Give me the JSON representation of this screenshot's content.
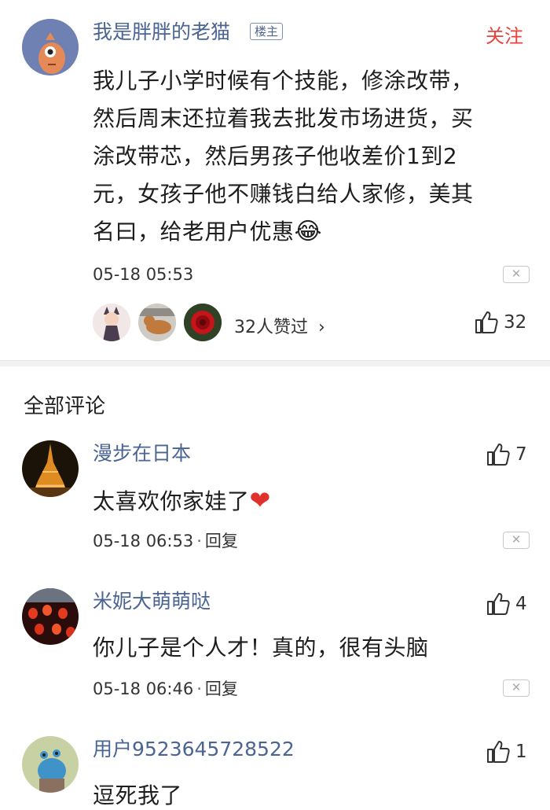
{
  "post": {
    "author": "我是胖胖的老猫",
    "badge": "楼主",
    "follow": "关注",
    "lines": [
      "我儿子小学时候有个技能，修涂改带，",
      "然后周末还拉着我去批发市场进货，买",
      "涂改带芯，然后男孩子他收差价1到2",
      "元，女孩子他不赚钱白给人家修，美其",
      "名曰，给老用户优惠"
    ],
    "emoji": "😂",
    "time": "05-18 05:53",
    "likers_text": "32人赞过",
    "likers_chevron": "›",
    "like_count": "32",
    "close": "✕"
  },
  "section_title": "全部评论",
  "comments": [
    {
      "user": "漫步在日本",
      "text": "太喜欢你家娃了",
      "emoji": "❤",
      "time": "05-18 06:53",
      "sep": "·",
      "reply": "回复",
      "likes": "7",
      "close": "✕"
    },
    {
      "user": "米妮大萌萌哒",
      "text": "你儿子是个人才！真的，很有头脑",
      "time": "05-18 06:46",
      "sep": "·",
      "reply": "回复",
      "likes": "4",
      "close": "✕"
    },
    {
      "user": "用户9523645728522",
      "text": "逗死我了",
      "likes": "1"
    }
  ],
  "colors": {
    "username": "#4a6592",
    "follow": "#e8423a",
    "heart": "#e0312d"
  }
}
